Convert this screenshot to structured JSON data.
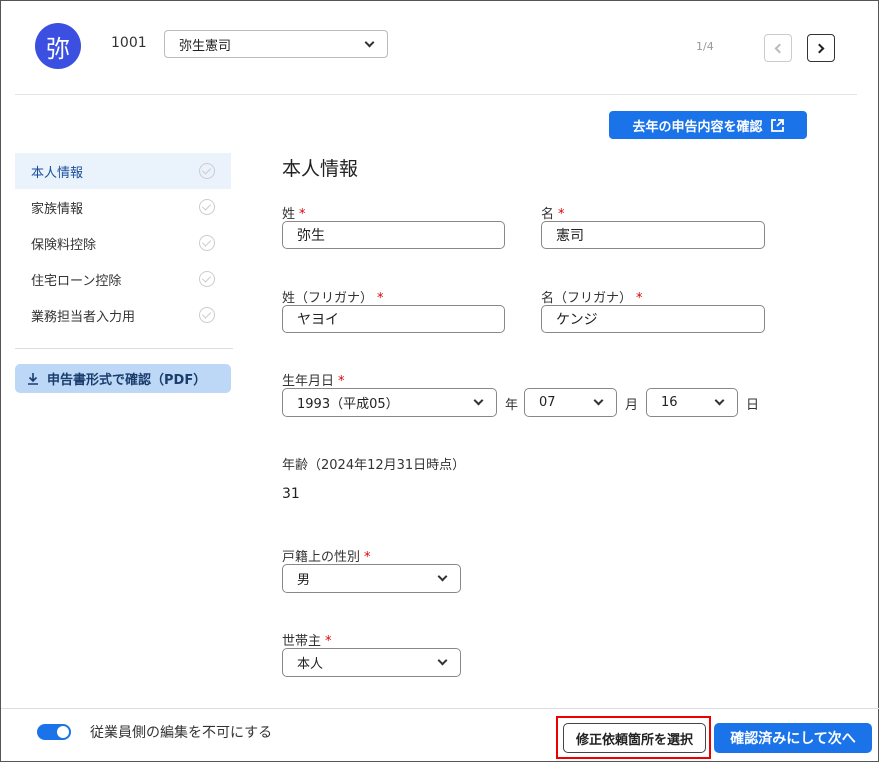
{
  "header": {
    "avatar_char": "弥",
    "employee_id": "1001",
    "employee_name": "弥生憲司",
    "pager": "1/4"
  },
  "actions": {
    "last_year_label": "去年の申告内容を確認"
  },
  "sidebar": {
    "items": [
      {
        "label": "本人情報"
      },
      {
        "label": "家族情報"
      },
      {
        "label": "保険料控除"
      },
      {
        "label": "住宅ローン控除"
      },
      {
        "label": "業務担当者入力用"
      }
    ],
    "pdf_label": "申告書形式で確認（PDF）"
  },
  "form": {
    "section_title": "本人情報",
    "required_mark": "*",
    "last_name": {
      "label": "姓",
      "value": "弥生"
    },
    "first_name": {
      "label": "名",
      "value": "憲司"
    },
    "last_name_kana": {
      "label": "姓（フリガナ）",
      "value": "ヤヨイ"
    },
    "first_name_kana": {
      "label": "名（フリガナ）",
      "value": "ケンジ"
    },
    "birthdate": {
      "label": "生年月日",
      "year": "1993（平成05）",
      "year_unit": "年",
      "month": "07",
      "month_unit": "月",
      "day": "16",
      "day_unit": "日"
    },
    "age": {
      "label": "年齢（2024年12月31日時点）",
      "value": "31"
    },
    "gender": {
      "label": "戸籍上の性別",
      "value": "男"
    },
    "householder": {
      "label": "世帯主",
      "value": "本人"
    }
  },
  "footer": {
    "toggle_label": "従業員側の編集を不可にする",
    "toggle_on": true,
    "fix_request_label": "修正依頼箇所を選択",
    "confirm_next_label": "確認済みにして次へ"
  },
  "colors": {
    "primary": "#1a73e8",
    "avatar": "#3b4fe0",
    "highlight": "#ee0000"
  }
}
